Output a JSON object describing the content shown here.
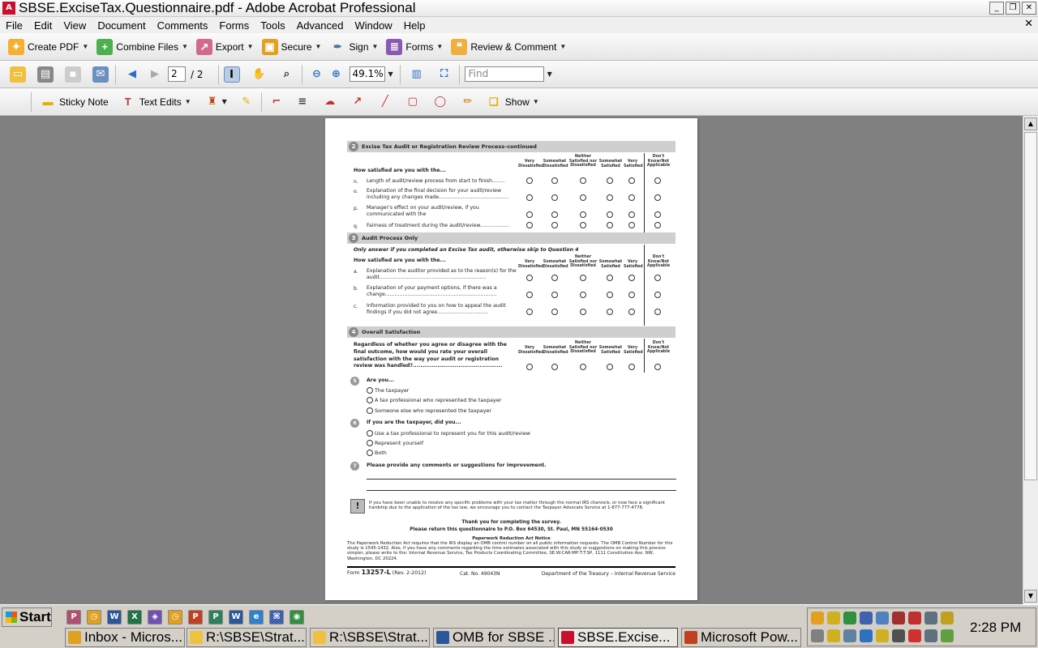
{
  "window": {
    "title": "SBSE.ExciseTax.Questionnaire.pdf - Adobe Acrobat Professional",
    "buttons": [
      "_",
      "❐",
      "✕"
    ]
  },
  "menu": [
    "File",
    "Edit",
    "View",
    "Document",
    "Comments",
    "Forms",
    "Tools",
    "Advanced",
    "Window",
    "Help"
  ],
  "toolbar1": {
    "create_pdf": "Create PDF",
    "combine_files": "Combine Files",
    "export": "Export",
    "secure": "Secure",
    "sign": "Sign",
    "forms": "Forms",
    "review_comment": "Review & Comment"
  },
  "toolbar2": {
    "page_current": "2",
    "page_total": "/ 2",
    "zoom": "49.1%",
    "find_placeholder": "Find"
  },
  "toolbar3": {
    "sticky_note": "Sticky Note",
    "text_edits": "Text Edits",
    "show": "Show"
  },
  "doc": {
    "rating_headers": [
      "Very Dissatisfied",
      "Somewhat Dissatisfied",
      "Neither Satisfied nor Dissatisfied",
      "Somewhat Satisfied",
      "Very Satisfied",
      "Don't Know/Not Applicable"
    ],
    "sec2": {
      "num": "2",
      "title": "Excise Tax Audit or Registration Review Process–continued",
      "prompt": "How satisfied are you with the...",
      "items": [
        {
          "letter": "n.",
          "text": "Length of audit/review process from start to finish........"
        },
        {
          "letter": "o.",
          "text": "Explanation of the final decision for your audit/review including any changes made............................................"
        },
        {
          "letter": "p.",
          "text": "Manager's effect on your audit/review, if you communicated with the manager..........................................."
        },
        {
          "letter": "q.",
          "text": "Fairness of treatment during the audit/review.................."
        }
      ]
    },
    "sec3": {
      "num": "3",
      "title": "Audit Process Only",
      "instruction": "Only answer if you completed an Excise Tax audit, otherwise skip to Question 4",
      "prompt": "How satisfied are you with the...",
      "items": [
        {
          "letter": "a.",
          "text": "Explanation the auditor provided as to the reason(s) for the audit..................................................................."
        },
        {
          "letter": "b.",
          "text": "Explanation of your payment options, if there was a change......................................................................"
        },
        {
          "letter": "c.",
          "text": "Information provided to you on how to appeal the audit findings if you did not agree................................"
        }
      ]
    },
    "sec4": {
      "num": "4",
      "title": "Overall Satisfaction",
      "question": "Regardless of whether you agree or disagree with the final outcome, how would you rate your overall satisfaction with the way your audit or registration review was handled?..............................................."
    },
    "q5": {
      "num": "5",
      "text": "Are you...",
      "options": [
        "The taxpayer",
        "A tax professional who represented the taxpayer",
        "Someone else who represented the taxpayer"
      ]
    },
    "q6": {
      "num": "6",
      "text": "If you are the taxpayer, did you...",
      "options": [
        "Use a tax professional to represent you for this audit/review",
        "Represent yourself",
        "Both"
      ]
    },
    "q7": {
      "num": "7",
      "text": "Please provide any comments or suggestions for improvement."
    },
    "advocate": {
      "icon": "!",
      "text": "If you have been unable to resolve any specific problems with your tax matter through the normal IRS channels, or now face a significant hardship due to the application of the tax law, we encourage you to contact the Taxpayer Advocate Service at 1-877-777-4778."
    },
    "thanks": "Thank you for completing the survey.",
    "return": "Please return this questionnaire to P.O. Box 64530, St. Paul, MN 55164-0530",
    "pra_title": "Paperwork Reduction Act Notice",
    "pra_text": "The Paperwork Reduction Act requires that the IRS display an OMB control number on all public information requests. The OMB Control Number for this study is 1545-1432. Also, if you have any comments regarding the time estimates associated with this study or suggestions on making this process simpler, please write to the: Internal Revenue Service, Tax Products Coordinating Committee, SE:W:CAR:MP:T:T:SP, 1111 Constitution Ave. NW, Washington, DC 20224.",
    "footer": {
      "form_prefix": "Form",
      "form_num": "13257-L",
      "form_rev": "(Rev. 2-2012)",
      "cat": "Cat. No. 49043N",
      "dept": "Department of the Treasury – Internal Revenue Service"
    }
  },
  "taskbar": {
    "start": "Start",
    "tasks": [
      "Inbox - Micros...",
      "R:\\SBSE\\Strat...",
      "R:\\SBSE\\Strat...",
      "OMB for SBSE ...",
      "SBSE.Excise...",
      "Microsoft Pow..."
    ],
    "clock": "2:28 PM"
  }
}
